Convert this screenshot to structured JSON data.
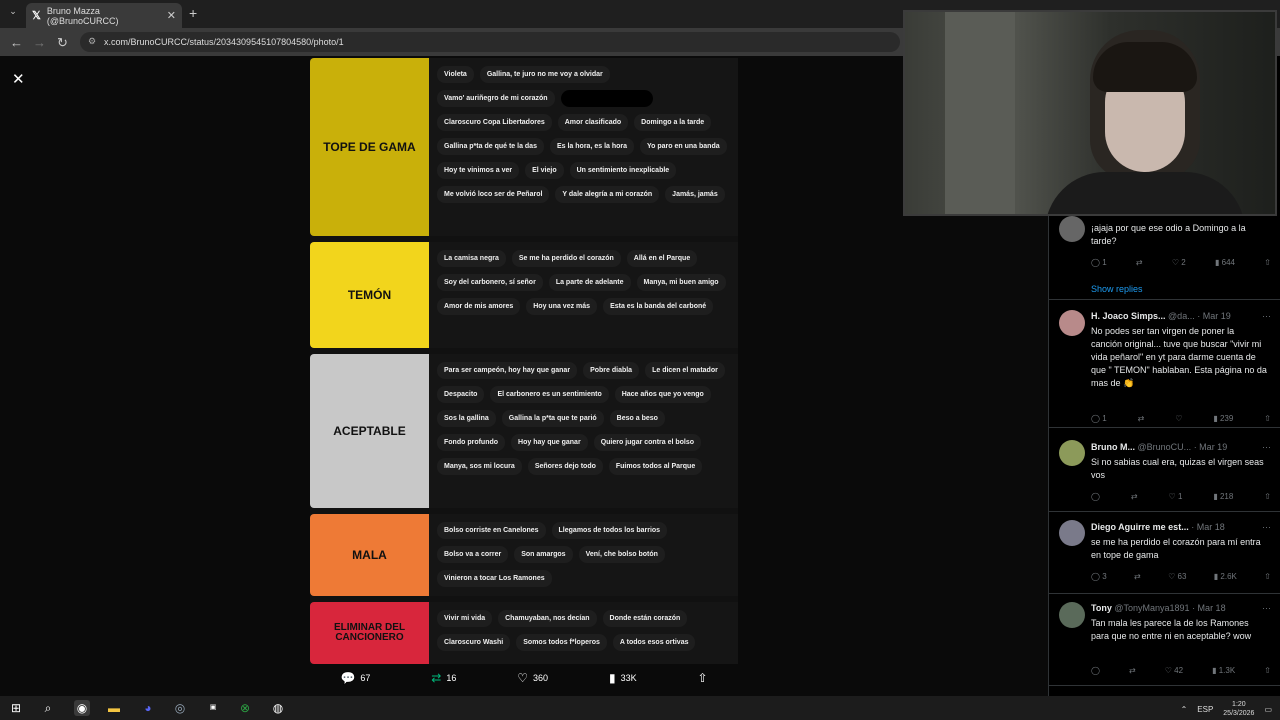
{
  "browser": {
    "tab_title": "Bruno Mazza (@BrunoCURCC)",
    "url": "x.com/BrunoCURCC/status/2034309545107804580/photo/1"
  },
  "tiers": [
    {
      "label": "TOPE DE GAMA",
      "color": "#c9b00a",
      "items": [
        "Violeta",
        "Gallina, te juro no me voy a olvidar",
        "Vamo' auriñegro de mi corazón",
        "",
        "Claroscuro Copa Libertadores",
        "Amor clasificado",
        "Domingo a la tarde",
        "Gallina p*ta de qué te la das",
        "Es la hora, es la hora",
        "Yo paro en una banda",
        "Hoy te vinimos a ver",
        "El viejo",
        "Un sentimiento inexplicable",
        "Me volvió loco ser de Peñarol",
        "Y dale alegría a mi corazón",
        "Jamás, jamás"
      ]
    },
    {
      "label": "TEMÓN",
      "color": "#f2d51c",
      "items": [
        "La camisa negra",
        "Se me ha perdido el corazón",
        "Allá en el Parque",
        "Soy del carbonero, sí señor",
        "La parte de adelante",
        "Manya, mi buen amigo",
        "Amor de mis amores",
        "Hoy una vez más",
        "Esta es la banda del carboné"
      ]
    },
    {
      "label": "ACEPTABLE",
      "color": "#c8c8c8",
      "items": [
        "Para ser campeón, hoy hay que ganar",
        "Pobre diabla",
        "Le dicen el matador",
        "Despacito",
        "El carbonero es un sentimiento",
        "Hace años que yo vengo",
        "Sos la gallina",
        "Gallina la p*ta que te parió",
        "Beso a beso",
        "Fondo profundo",
        "Hoy hay que ganar",
        "Quiero jugar contra el bolso",
        "Manya, sos mi locura",
        "Señores dejo todo",
        "Fuimos todos al Parque"
      ]
    },
    {
      "label": "MALA",
      "color": "#ee7a36",
      "items": [
        "Bolso corriste en Canelones",
        "Llegamos de todos los barrios",
        "Bolso va a correr",
        "Son amargos",
        "Vení, che bolso botón",
        "Vinieron a tocar Los Ramones"
      ]
    },
    {
      "label": "ELIMINAR DEL CANCIONERO",
      "color": "#d8263c",
      "items": [
        "Vivir mi vida",
        "Chamuyaban, nos decían",
        "Donde están corazón",
        "Claroscuro Washi",
        "Somos todos f*loperos",
        "A todos esos ortivas"
      ]
    }
  ],
  "actions": {
    "replies": "67",
    "reposts": "16",
    "likes": "360",
    "views": "33K"
  },
  "replies": [
    {
      "name": "",
      "handle": "",
      "date": "",
      "text": "¡ajaja por que ese odio a Domingo a la tarde?",
      "reply_count": "1",
      "repost_count": "",
      "like_count": "2",
      "view_count": "644",
      "show_replies": "Show replies"
    },
    {
      "name": "H. Joaco Simps...",
      "handle": "@da...",
      "date": "· Mar 19",
      "text": "No podes ser tan virgen de poner la canción original... tuve que buscar \"vivir mi vida peñarol\" en yt para darme cuenta de que \" TEMON\" hablaban. Esta página no da mas de 👏",
      "reply_count": "1",
      "repost_count": "",
      "like_count": "",
      "view_count": "239"
    },
    {
      "name": "Bruno M...",
      "handle": "@BrunoCU...",
      "date": "· Mar 19",
      "text": "Si no sabias cual era, quizas el virgen seas vos",
      "reply_count": "",
      "repost_count": "",
      "like_count": "1",
      "view_count": "218"
    },
    {
      "name": "Diego Aguirre me est...",
      "handle": "",
      "date": "· Mar 18",
      "text": "se me ha perdido el corazón para mí entra en tope de gama",
      "reply_count": "3",
      "repost_count": "",
      "like_count": "63",
      "view_count": "2.6K"
    },
    {
      "name": "Tony",
      "handle": "@TonyManya1891",
      "date": "· Mar 18",
      "text": "Tan mala les parece la de los Ramones para que no entre ni en aceptable? wow",
      "reply_count": "",
      "repost_count": "",
      "like_count": "42",
      "view_count": "1.3K"
    }
  ],
  "taskbar": {
    "lang": "ESP",
    "time": "1:20",
    "date": "25/3/2026"
  }
}
